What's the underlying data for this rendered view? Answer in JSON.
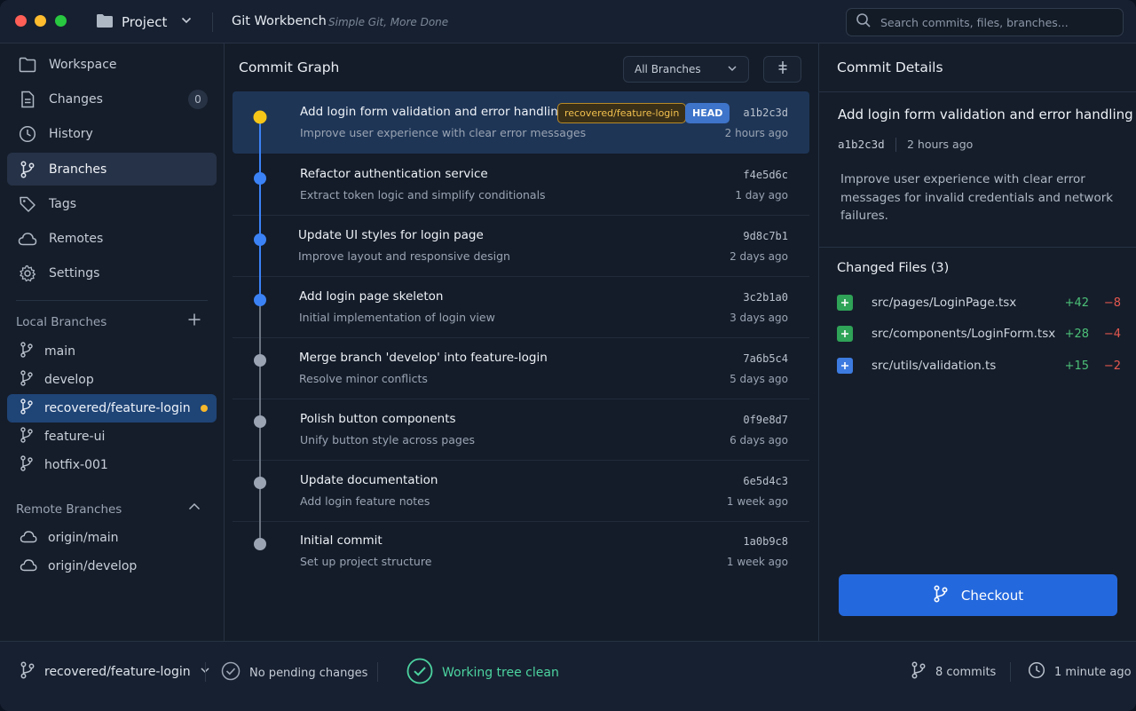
{
  "titlebar": {
    "project_label": "Project",
    "app_title": "Git Workbench",
    "tagline": "Simple Git, More Done",
    "search_placeholder": "Search commits, files, branches..."
  },
  "sidebar": {
    "nav": [
      {
        "label": "Workspace",
        "icon": "folder-icon"
      },
      {
        "label": "Changes",
        "icon": "file-icon",
        "count": "0"
      },
      {
        "label": "History",
        "icon": "clock-icon"
      },
      {
        "label": "Branches",
        "icon": "branch-icon"
      },
      {
        "label": "Tags",
        "icon": "tag-icon"
      },
      {
        "label": "Remotes",
        "icon": "cloud-icon"
      },
      {
        "label": "Settings",
        "icon": "gear-icon"
      }
    ],
    "local_title": "Local Branches",
    "local_branches": [
      "main",
      "develop",
      "recovered/feature-login",
      "feature-ui",
      "hotfix-001"
    ],
    "remote_title": "Remote Branches",
    "remote_branches": [
      "origin/main",
      "origin/develop"
    ]
  },
  "graph": {
    "title": "Commit Graph",
    "filter": "All Branches",
    "commits": [
      {
        "title": "Add login form validation and error handling",
        "message": "Improve user experience with clear error messages",
        "hash": "a1b2c3d",
        "time": "2 hours ago",
        "branch_tag": "recovered/feature-login",
        "head_tag": "HEAD"
      },
      {
        "title": "Refactor authentication service",
        "message": "Extract token logic and simplify conditionals",
        "hash": "f4e5d6c",
        "time": "1 day ago"
      },
      {
        "title": "Update UI styles for login page",
        "message": "Improve layout and responsive design",
        "hash": "9d8c7b1",
        "time": "2 days ago"
      },
      {
        "title": "Add login page skeleton",
        "message": "Initial implementation of login view",
        "hash": "3c2b1a0",
        "time": "3 days ago"
      },
      {
        "title": "Merge branch 'develop' into feature-login",
        "message": "Resolve minor conflicts",
        "hash": "7a6b5c4",
        "time": "5 days ago"
      },
      {
        "title": "Polish button components",
        "message": "Unify button style across pages",
        "hash": "0f9e8d7",
        "time": "6 days ago"
      },
      {
        "title": "Update documentation",
        "message": "Add login feature notes",
        "hash": "6e5d4c3",
        "time": "1 week ago"
      },
      {
        "title": "Initial commit",
        "message": "Set up project structure",
        "hash": "1a0b9c8",
        "time": "1 week ago"
      }
    ]
  },
  "details": {
    "title": "Commit Details",
    "commit_title": "Add login form validation and error handling",
    "hash": "a1b2c3d",
    "time": "2 hours ago",
    "description": "Improve user experience with clear error messages for invalid credentials and network failures.",
    "files_title": "Changed Files (3)",
    "files": [
      {
        "name": "src/pages/LoginPage.tsx",
        "added": "+42",
        "removed": "−8",
        "status": "added"
      },
      {
        "name": "src/components/LoginForm.tsx",
        "added": "+28",
        "removed": "−4",
        "status": "added"
      },
      {
        "name": "src/utils/validation.ts",
        "added": "+15",
        "removed": "−2",
        "status": "modified"
      }
    ],
    "checkout_label": "Checkout"
  },
  "statusbar": {
    "branch": "recovered/feature-login",
    "pending": "No pending changes",
    "clean": "Working tree clean",
    "commits": "8 commits",
    "updated": "1 minute ago"
  },
  "colors": {
    "accent": "#2468dd",
    "head_commit": "#f5c518",
    "commit_blue": "#3b82f6",
    "commit_gray": "#9aa4b3",
    "added": "#4cc078",
    "removed": "#e5584f",
    "clean": "#4cd3a0"
  }
}
